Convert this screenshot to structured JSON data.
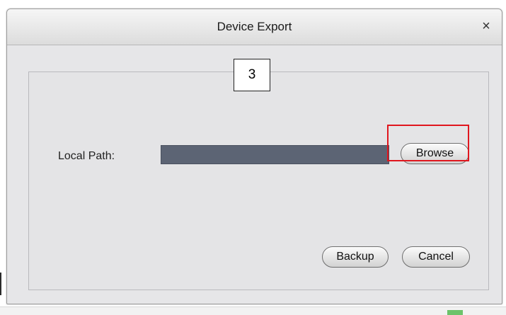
{
  "dialog": {
    "title": "Device Export",
    "close_glyph": "×",
    "close_icon": "close-icon"
  },
  "annotation": {
    "step_number": "3",
    "highlight_color": "#e0161e"
  },
  "form": {
    "local_path_label": "Local Path:",
    "local_path_value": "",
    "input_color": "#5c6474"
  },
  "buttons": {
    "browse_label": "Browse",
    "backup_label": "Backup",
    "cancel_label": "Cancel"
  }
}
